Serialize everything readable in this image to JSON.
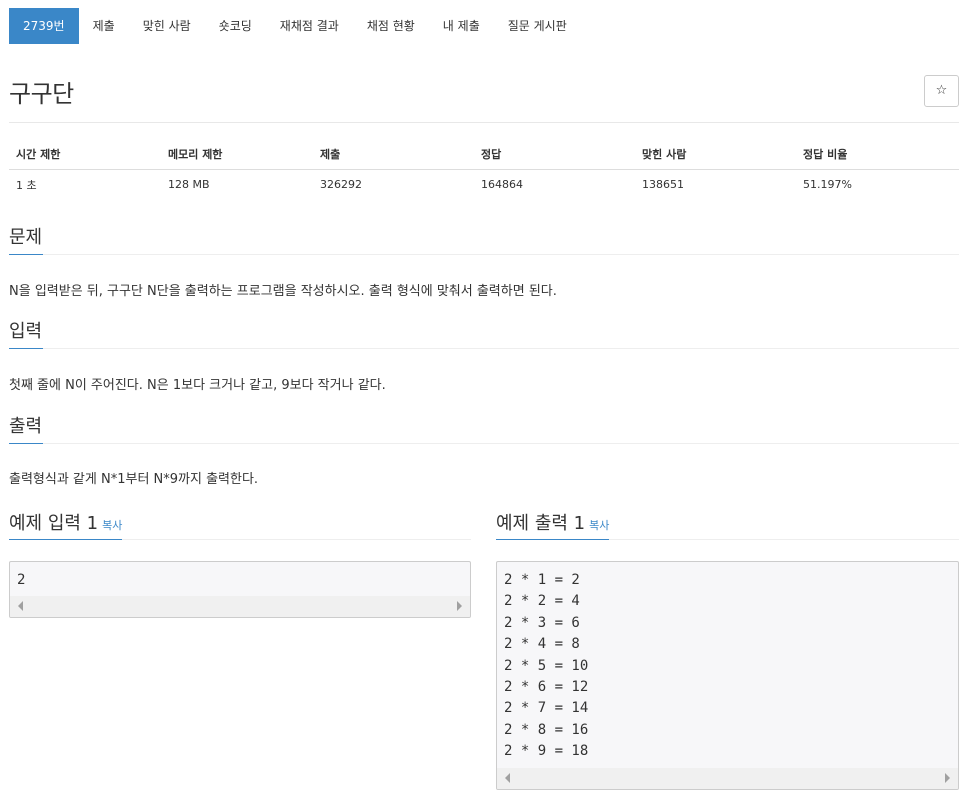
{
  "tabs": [
    "2739번",
    "제출",
    "맞힌 사람",
    "숏코딩",
    "재채점 결과",
    "채점 현황",
    "내 제출",
    "질문 게시판"
  ],
  "title": "구구단",
  "star_icon": "☆",
  "info": {
    "headers": [
      "시간 제한",
      "메모리 제한",
      "제출",
      "정답",
      "맞힌 사람",
      "정답 비율"
    ],
    "values": [
      "1 초",
      "128 MB",
      "326292",
      "164864",
      "138651",
      "51.197%"
    ]
  },
  "problem": {
    "heading": "문제",
    "text": "N을 입력받은 뒤, 구구단 N단을 출력하는 프로그램을 작성하시오. 출력 형식에 맞춰서 출력하면 된다."
  },
  "input": {
    "heading": "입력",
    "text": "첫째 줄에 N이 주어진다. N은 1보다 크거나 같고, 9보다 작거나 같다."
  },
  "output": {
    "heading": "출력",
    "text": "출력형식과 같게 N*1부터 N*9까지 출력한다."
  },
  "sample_input": {
    "heading": "예제 입력 1",
    "copy": "복사",
    "code": "2"
  },
  "sample_output": {
    "heading": "예제 출력 1",
    "copy": "복사",
    "code": "2 * 1 = 2\n2 * 2 = 4\n2 * 3 = 6\n2 * 4 = 8\n2 * 5 = 10\n2 * 6 = 12\n2 * 7 = 14\n2 * 8 = 16\n2 * 9 = 18"
  },
  "colors": {
    "accent": "#3a87c8",
    "code_bg": "#f7f7f9"
  }
}
